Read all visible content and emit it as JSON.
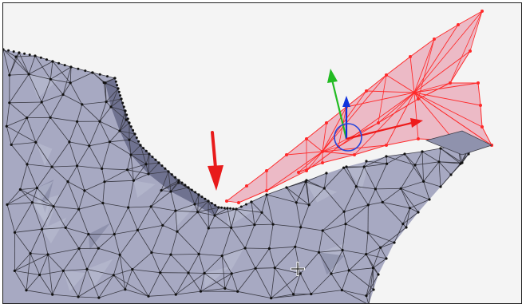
{
  "viewport": {
    "background": "#f4f4f4",
    "border_color": "#1e1e1e"
  },
  "mesh": {
    "face_color": "#a7a9c2",
    "face_light": "#bcbfd4",
    "face_dark": "#7c7f9c",
    "edge_color": "#3a3a44",
    "vertex_color": "#111111"
  },
  "selection": {
    "face_color": "#e9a9b9",
    "edge_color": "#ff2a2a",
    "vertex_color": "#ff2a2a",
    "opacity": 0.78
  },
  "gizmo": {
    "x_axis_color": "#ee1b1b",
    "y_axis_color": "#22bb22",
    "z_axis_color": "#1133dd",
    "ring_color": "#2244dd"
  },
  "annotation": {
    "arrow_color": "#e81b1b"
  },
  "icons": {
    "cursor": "move-cursor-icon",
    "pointer": "annotation-arrow-icon",
    "gizmo": "transform-gizmo-icon"
  }
}
